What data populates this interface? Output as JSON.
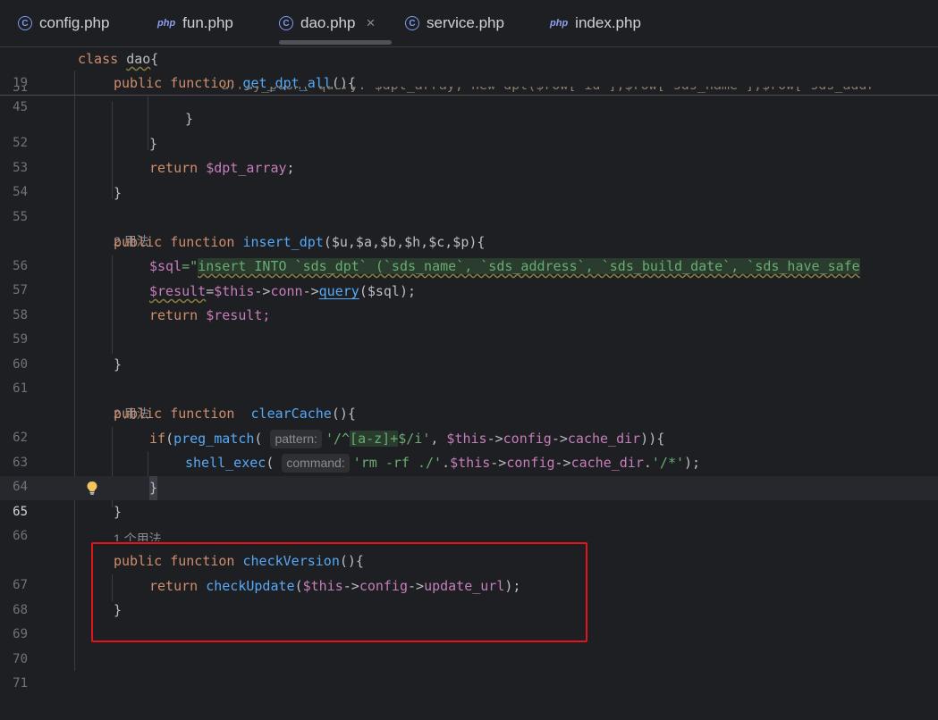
{
  "tabs": [
    {
      "label": "config.php",
      "icon": "c-class-icon"
    },
    {
      "label": "fun.php",
      "icon": "php-icon",
      "icon_text": "php"
    },
    {
      "label": "dao.php",
      "icon": "c-class-icon",
      "active": true,
      "close": "×"
    },
    {
      "label": "service.php",
      "icon": "c-class-icon"
    },
    {
      "label": "index.php",
      "icon": "php-icon",
      "icon_text": "php"
    }
  ],
  "icons": {
    "c_glyph": "C",
    "lightbulb": "lightbulb-icon"
  },
  "lines": {
    "19": "19",
    "45": "45",
    "51": "51",
    "52": "52",
    "53": "53",
    "54": "54",
    "55": "55",
    "56": "56",
    "57": "57",
    "58": "58",
    "59": "59",
    "60": "60",
    "61": "61",
    "62": "62",
    "63": "63",
    "64": "64",
    "65": "65",
    "66": "66",
    "67": "67",
    "68": "68",
    "69": "69",
    "70": "70",
    "71": "71"
  },
  "hints": {
    "usage_2a": "2 用法",
    "usage_2b": "2 用法",
    "usage_1": "1 个用法"
  },
  "code": {
    "class_kw": "class",
    "class_name": "dao",
    "brace_open": "{",
    "public": "public",
    "function": "function",
    "return": "return",
    "if": "if",
    "get_dpt_all": "get_dpt_all",
    "insert_dpt": "insert_dpt",
    "clearCache": "clearCache",
    "checkVersion": "checkVersion",
    "paren_empty_brace": "(){",
    "array_push_line": "array_push( query: $dpt_array, new dpt($row['id'],$row['sds_name'],$row['sds_addr",
    "close_brace": "}",
    "dpt_array": "$dpt_array",
    "semicolon": ";",
    "insert_params": "($u,$a,$b,$h,$c,$p){",
    "sql_var": "$sql",
    "sql_eq": "=\"",
    "sql_text": "insert INTO `sds_dpt` (`sds_name`, `sds_address`, `sds_build_date`, `sds_have_safe",
    "result_var": "$result",
    "eq": "=",
    "this": "$this",
    "arrow": "->",
    "conn": "conn",
    "query": "query",
    "sql_arg": "($sql);",
    "result_ret": "$result;",
    "preg_match": "preg_match",
    "paren_open": "(",
    "pattern_hint": "pattern:",
    "regex_a": "'/^",
    "regex_b": "[a-z]+",
    "regex_c": "$/i'",
    "comma": ", ",
    "config": "config",
    "cache_dir": "cache_dir",
    "close_if": ")){",
    "shell_exec": "shell_exec",
    "command_hint": "command:",
    "rm_str": "'rm -rf ./'",
    "dot": ".",
    "slash_str": "'/*'",
    "end_call": ");",
    "checkUpdate": "checkUpdate",
    "update_url": "update_url"
  }
}
